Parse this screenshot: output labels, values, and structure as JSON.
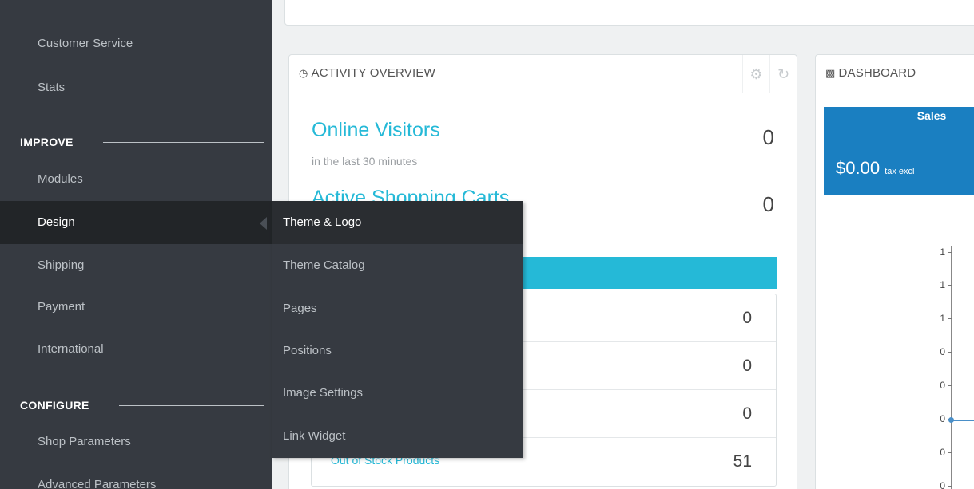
{
  "sidebar": {
    "items": [
      {
        "label": "Customer Service"
      },
      {
        "label": "Stats"
      },
      {
        "label": "Modules"
      },
      {
        "label": "Design"
      },
      {
        "label": "Shipping"
      },
      {
        "label": "Payment"
      },
      {
        "label": "International"
      },
      {
        "label": "Shop Parameters"
      },
      {
        "label": "Advanced Parameters"
      }
    ],
    "sections": {
      "improve": "IMPROVE",
      "configure": "CONFIGURE"
    }
  },
  "submenu": {
    "items": [
      {
        "label": "Theme & Logo"
      },
      {
        "label": "Theme Catalog"
      },
      {
        "label": "Pages"
      },
      {
        "label": "Positions"
      },
      {
        "label": "Image Settings"
      },
      {
        "label": "Link Widget"
      }
    ]
  },
  "activity": {
    "title": "ACTIVITY OVERVIEW",
    "online_visitors": {
      "label": "Online Visitors",
      "caption": "in the last 30 minutes",
      "value": "0"
    },
    "active_carts": {
      "label": "Active Shopping Carts",
      "value": "0"
    },
    "stats": [
      {
        "label": "",
        "value": "0"
      },
      {
        "label": "",
        "value": "0"
      },
      {
        "label": "",
        "value": "0"
      },
      {
        "label": "Out of Stock Products",
        "value": "51"
      }
    ]
  },
  "dashboard": {
    "title": "DASHBOARD",
    "sales": {
      "title": "Sales",
      "value": "$0.00",
      "suffix": "tax excl"
    },
    "yticks": [
      "1",
      "1",
      "1",
      "0",
      "0",
      "0",
      "0",
      "0"
    ]
  },
  "colors": {
    "accent": "#25b9d7",
    "sidebar": "#363a41",
    "sales_tile": "#1a7fc1"
  }
}
